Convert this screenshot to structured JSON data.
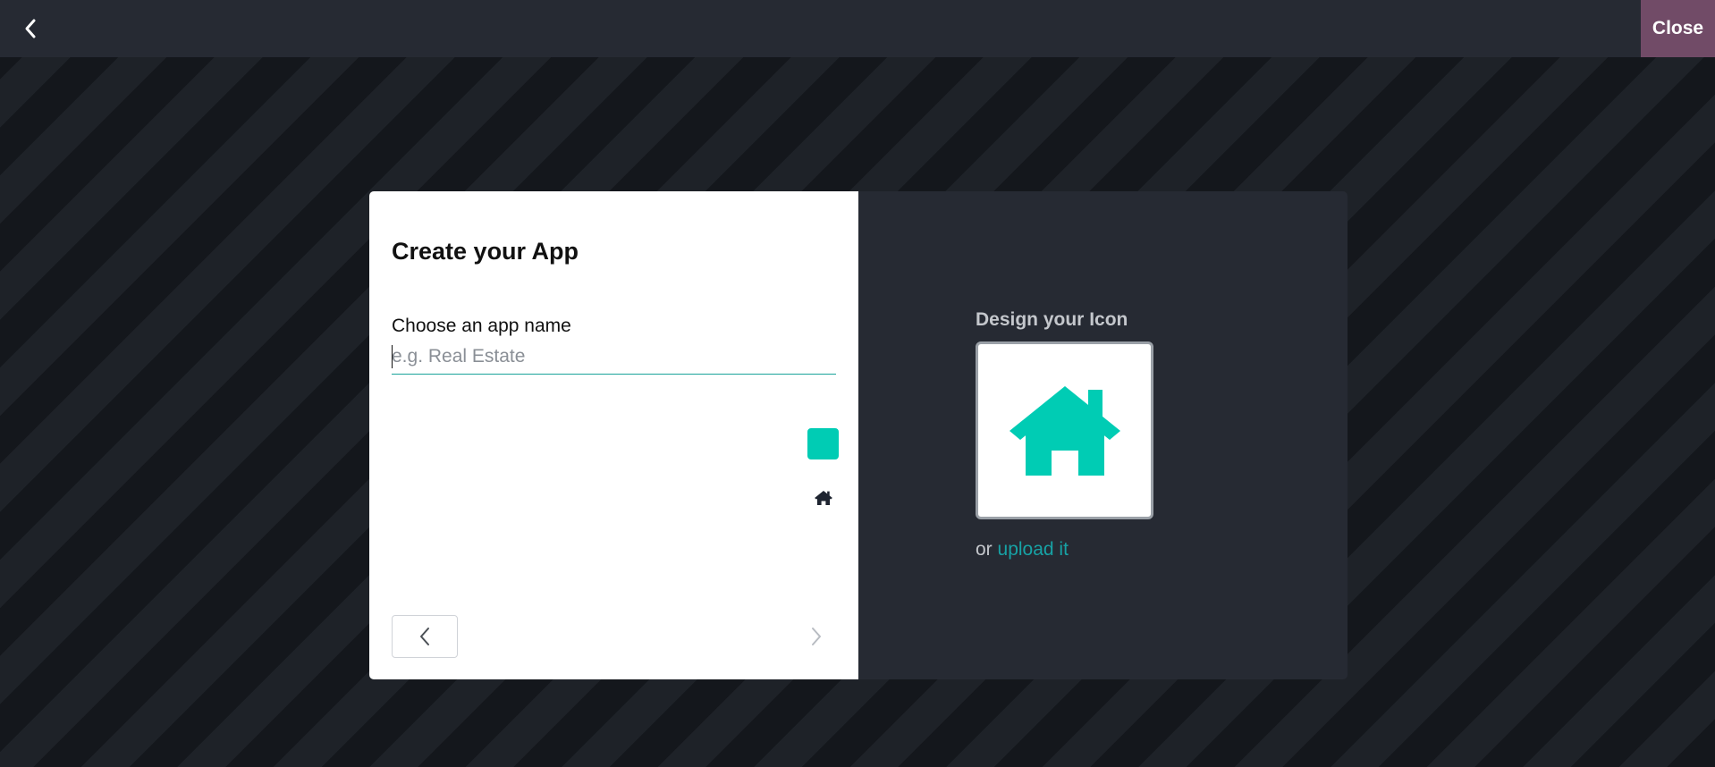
{
  "topbar": {
    "back_icon": "chevron-left-icon",
    "close_label": "Close",
    "close_color": "#714b67"
  },
  "dialog": {
    "title": "Create your App",
    "app_name": {
      "label": "Choose an app name",
      "placeholder": "e.g. Real Estate",
      "value": ""
    },
    "nav": {
      "prev_icon": "chevron-left-icon",
      "next_icon": "chevron-right-icon"
    },
    "icon_designer": {
      "label": "Design your Icon",
      "preview_icon": "home-icon",
      "icon_color": "#00ccb4",
      "background_color": "#ffffff",
      "swatches": {
        "background": "#ffffff",
        "icon_color": "#00ccb4",
        "icon_picker": "home-icon"
      },
      "upload_prefix": "or",
      "upload_link": "upload it"
    }
  }
}
